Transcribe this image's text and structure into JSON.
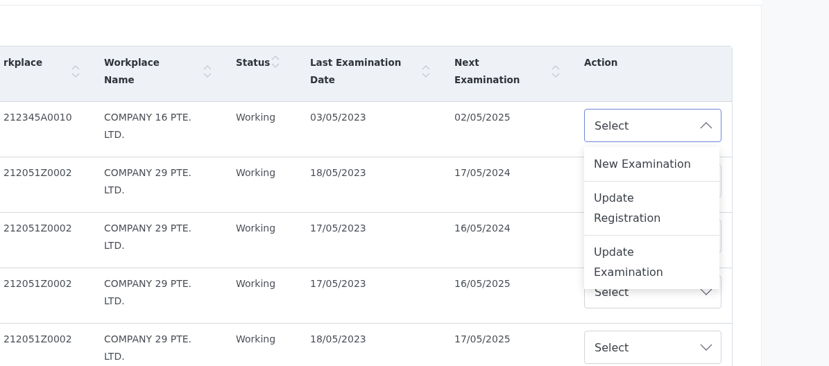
{
  "table": {
    "columns": [
      {
        "label": "rkplace",
        "sortable": true
      },
      {
        "label": "Workplace Name",
        "sortable": true
      },
      {
        "label": "Status",
        "sortable": true
      },
      {
        "label": "Last Examination Date",
        "sortable": true
      },
      {
        "label": "Next Examination",
        "sortable": true
      },
      {
        "label": "Action",
        "sortable": false
      }
    ],
    "rows": [
      {
        "cells": [
          "212345A0010",
          "COMPANY 16 PTE. LTD.",
          "Working",
          "03/05/2023",
          "02/05/2025"
        ],
        "action": {
          "label": "Select",
          "expanded": true,
          "options": [
            "New Examination",
            "Update Registration",
            "Update Examination"
          ]
        }
      },
      {
        "cells": [
          "212051Z0002",
          "COMPANY 29 PTE. LTD.",
          "Working",
          "18/05/2023",
          "17/05/2024"
        ],
        "action": {
          "expanded": false
        }
      },
      {
        "cells": [
          "212051Z0002",
          "COMPANY 29 PTE. LTD.",
          "Working",
          "17/05/2023",
          "16/05/2024"
        ],
        "action": {
          "expanded": false
        }
      },
      {
        "cells": [
          "212051Z0002",
          "COMPANY 29 PTE. LTD.",
          "Working",
          "17/05/2023",
          "16/05/2025"
        ],
        "action": {
          "label": "Select",
          "expanded": false
        }
      },
      {
        "cells": [
          "212051Z0002",
          "COMPANY 29 PTE. LTD.",
          "Working",
          "18/05/2023",
          "17/05/2025"
        ],
        "action": {
          "label": "Select",
          "expanded": false
        }
      }
    ]
  }
}
